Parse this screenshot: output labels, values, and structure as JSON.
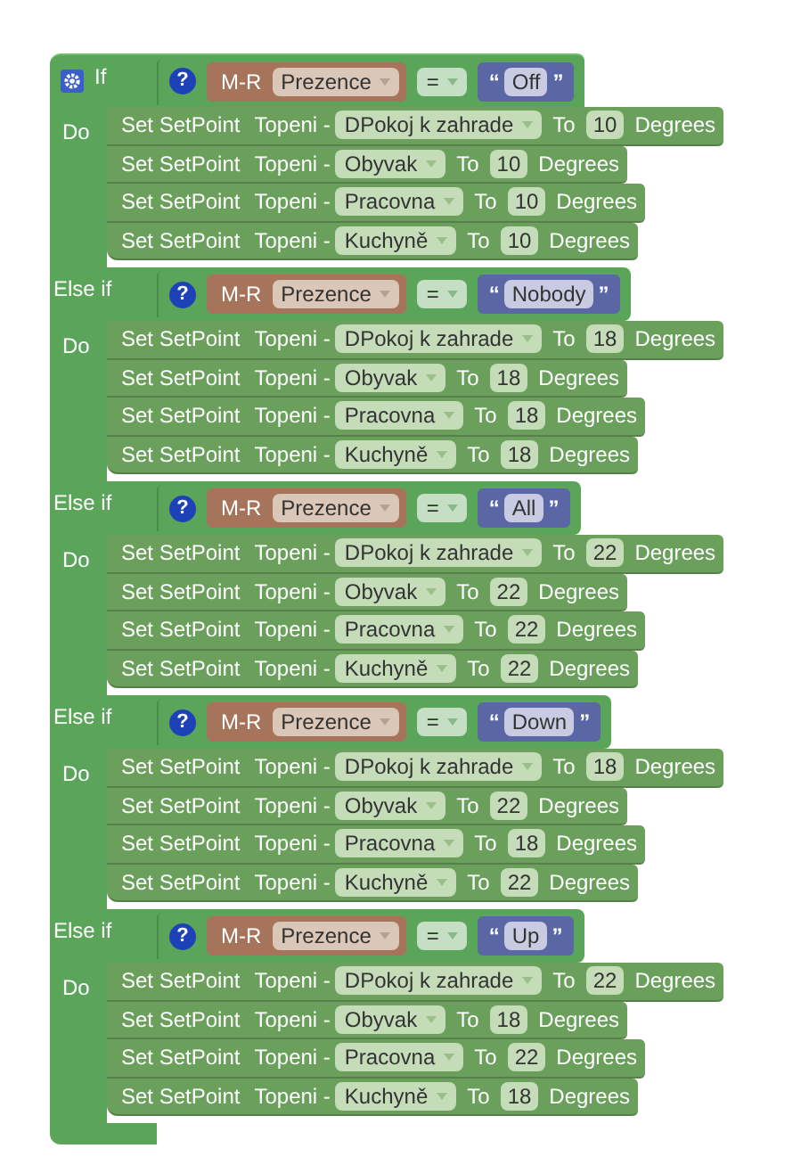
{
  "clauses": [
    {
      "kind": "if",
      "label": "If",
      "help": "?",
      "condition": {
        "block": "M-R",
        "field": "Prezence",
        "operator": "=",
        "open_quote": "“",
        "value": "Off",
        "close_quote": "”"
      },
      "do_label": "Do",
      "statements": [
        {
          "set": "Set SetPoint",
          "device": "Topeni -",
          "room": "DPokoj k zahrade",
          "to": "To",
          "value": "10",
          "unit": "Degrees"
        },
        {
          "set": "Set SetPoint",
          "device": "Topeni -",
          "room": "Obyvak",
          "to": "To",
          "value": "10",
          "unit": "Degrees"
        },
        {
          "set": "Set SetPoint",
          "device": "Topeni -",
          "room": "Pracovna",
          "to": "To",
          "value": "10",
          "unit": "Degrees"
        },
        {
          "set": "Set SetPoint",
          "device": "Topeni -",
          "room": "Kuchyně",
          "to": "To",
          "value": "10",
          "unit": "Degrees"
        }
      ]
    },
    {
      "kind": "else_if",
      "label": "Else if",
      "help": "?",
      "condition": {
        "block": "M-R",
        "field": "Prezence",
        "operator": "=",
        "open_quote": "“",
        "value": "Nobody",
        "close_quote": "”"
      },
      "do_label": "Do",
      "statements": [
        {
          "set": "Set SetPoint",
          "device": "Topeni -",
          "room": "DPokoj k zahrade",
          "to": "To",
          "value": "18",
          "unit": "Degrees"
        },
        {
          "set": "Set SetPoint",
          "device": "Topeni -",
          "room": "Obyvak",
          "to": "To",
          "value": "18",
          "unit": "Degrees"
        },
        {
          "set": "Set SetPoint",
          "device": "Topeni -",
          "room": "Pracovna",
          "to": "To",
          "value": "18",
          "unit": "Degrees"
        },
        {
          "set": "Set SetPoint",
          "device": "Topeni -",
          "room": "Kuchyně",
          "to": "To",
          "value": "18",
          "unit": "Degrees"
        }
      ]
    },
    {
      "kind": "else_if",
      "label": "Else if",
      "help": "?",
      "condition": {
        "block": "M-R",
        "field": "Prezence",
        "operator": "=",
        "open_quote": "“",
        "value": "All",
        "close_quote": "”"
      },
      "do_label": "Do",
      "statements": [
        {
          "set": "Set SetPoint",
          "device": "Topeni -",
          "room": "DPokoj k zahrade",
          "to": "To",
          "value": "22",
          "unit": "Degrees"
        },
        {
          "set": "Set SetPoint",
          "device": "Topeni -",
          "room": "Obyvak",
          "to": "To",
          "value": "22",
          "unit": "Degrees"
        },
        {
          "set": "Set SetPoint",
          "device": "Topeni -",
          "room": "Pracovna",
          "to": "To",
          "value": "22",
          "unit": "Degrees"
        },
        {
          "set": "Set SetPoint",
          "device": "Topeni -",
          "room": "Kuchyně",
          "to": "To",
          "value": "22",
          "unit": "Degrees"
        }
      ]
    },
    {
      "kind": "else_if",
      "label": "Else if",
      "help": "?",
      "condition": {
        "block": "M-R",
        "field": "Prezence",
        "operator": "=",
        "open_quote": "“",
        "value": "Down",
        "close_quote": "”"
      },
      "do_label": "Do",
      "statements": [
        {
          "set": "Set SetPoint",
          "device": "Topeni -",
          "room": "DPokoj k zahrade",
          "to": "To",
          "value": "18",
          "unit": "Degrees"
        },
        {
          "set": "Set SetPoint",
          "device": "Topeni -",
          "room": "Obyvak",
          "to": "To",
          "value": "22",
          "unit": "Degrees"
        },
        {
          "set": "Set SetPoint",
          "device": "Topeni -",
          "room": "Pracovna",
          "to": "To",
          "value": "18",
          "unit": "Degrees"
        },
        {
          "set": "Set SetPoint",
          "device": "Topeni -",
          "room": "Kuchyně",
          "to": "To",
          "value": "22",
          "unit": "Degrees"
        }
      ]
    },
    {
      "kind": "else_if",
      "label": "Else if",
      "help": "?",
      "condition": {
        "block": "M-R",
        "field": "Prezence",
        "operator": "=",
        "open_quote": "“",
        "value": "Up",
        "close_quote": "”"
      },
      "do_label": "Do",
      "statements": [
        {
          "set": "Set SetPoint",
          "device": "Topeni -",
          "room": "DPokoj k zahrade",
          "to": "To",
          "value": "22",
          "unit": "Degrees"
        },
        {
          "set": "Set SetPoint",
          "device": "Topeni -",
          "room": "Obyvak",
          "to": "To",
          "value": "18",
          "unit": "Degrees"
        },
        {
          "set": "Set SetPoint",
          "device": "Topeni -",
          "room": "Pracovna",
          "to": "To",
          "value": "22",
          "unit": "Degrees"
        },
        {
          "set": "Set SetPoint",
          "device": "Topeni -",
          "room": "Kuchyně",
          "to": "To",
          "value": "18",
          "unit": "Degrees"
        }
      ]
    }
  ]
}
